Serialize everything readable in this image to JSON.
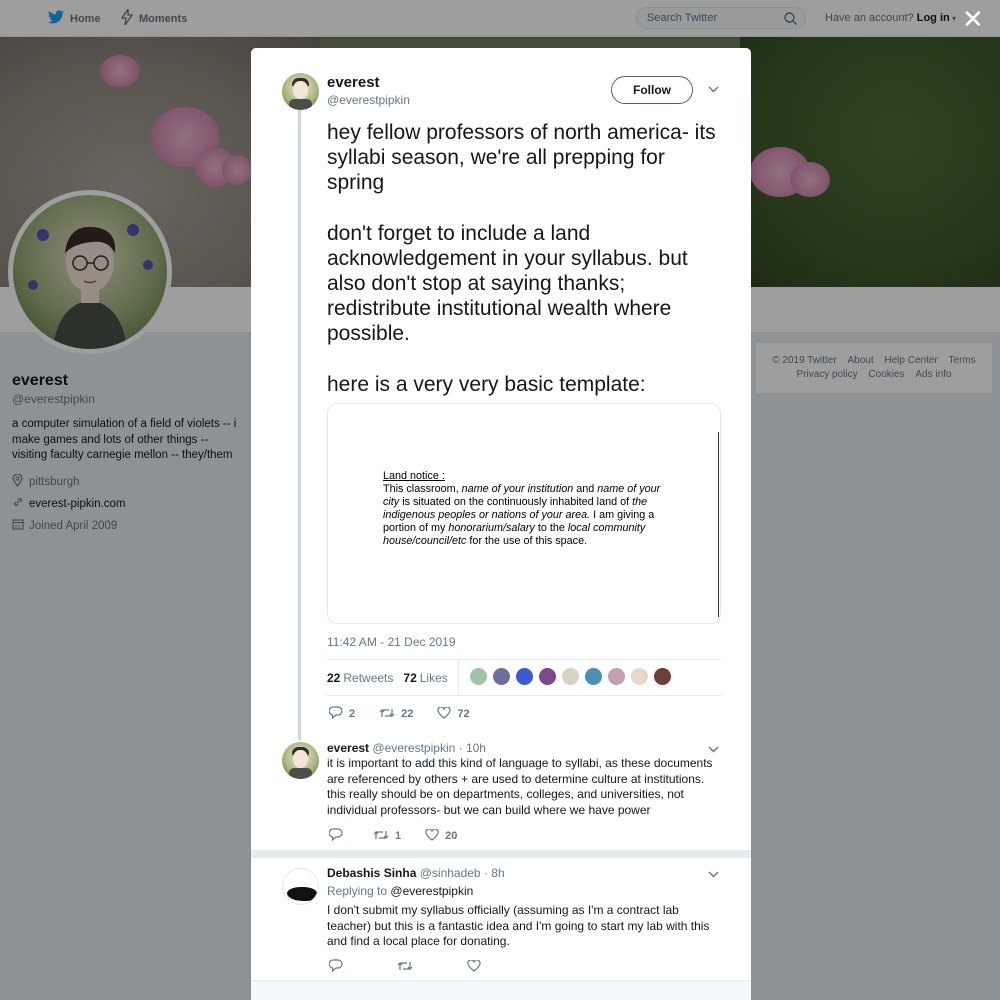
{
  "nav": {
    "home": "Home",
    "moments": "Moments",
    "search_placeholder": "Search Twitter",
    "have_account": "Have an account?",
    "login": "Log in"
  },
  "profile": {
    "name": "everest",
    "handle": "@everestpipkin",
    "bio": "a computer simulation of a field of violets -- i make games and lots of other things -- visiting faculty carnegie mellon -- they/them",
    "location": "pittsburgh",
    "website": "everest-pipkin.com",
    "joined": "Joined April 2009"
  },
  "footer": {
    "links": [
      "© 2019 Twitter",
      "About",
      "Help Center",
      "Terms",
      "Privacy policy",
      "Cookies",
      "Ads info"
    ]
  },
  "tweet": {
    "name": "everest",
    "handle": "@everestpipkin",
    "follow_label": "Follow",
    "paragraphs": [
      "hey fellow professors of north america- its syllabi season, we're all prepping for spring",
      "don't forget to include a land acknowledgement in your syllabus. but also don't stop at saying thanks; redistribute institutional wealth where possible.",
      "here is a very very basic template:"
    ],
    "image_doc": {
      "heading": "Land notice :",
      "t1": "This classroom, ",
      "i1": "name of your institution",
      "t2": " and ",
      "i2": "name of your city",
      "t3": " is situated on the continuously inhabited land of ",
      "i3": "the indigenous peoples or nations of your area.",
      "t4": " I am giving a portion of my ",
      "i4": "honorarium/salary",
      "t5": " to the ",
      "i5": "local community house/council/etc",
      "t6": " for the use of this space."
    },
    "timestamp": "11:42 AM - 21 Dec 2019",
    "retweets": "22",
    "retweets_label": "Retweets",
    "likes": "72",
    "likes_label": "Likes",
    "reply_count": "2",
    "retweet_count": "22",
    "like_count": "72",
    "liker_colors": [
      "#9fc5a8",
      "#6b6f9e",
      "#3b5bd6",
      "#7a4a8c",
      "#d9d2c5",
      "#4a8fb5",
      "#c6a0b0",
      "#e7d8c8",
      "#6b3f3a"
    ]
  },
  "reply1": {
    "name": "everest",
    "handle": "@everestpipkin",
    "time": "· 10h",
    "text": "it is important to add this kind of language to syllabi, as these documents are referenced by others + are used to determine culture at institutions. this really should be on departments, colleges, and universities, not individual professors- but we can build where we have power",
    "reply_count": "",
    "retweet_count": "1",
    "like_count": "20"
  },
  "reply2": {
    "name": "Debashis Sinha",
    "handle": "@sinhadeb",
    "time": "· 8h",
    "replying_label": "Replying to",
    "replying_to": "@everestpipkin",
    "text": "I don't submit my syllabus officially (assuming as I'm a contract lab teacher) but this is a fantastic idea and I'm going to start my lab with this and find a local place for donating."
  }
}
